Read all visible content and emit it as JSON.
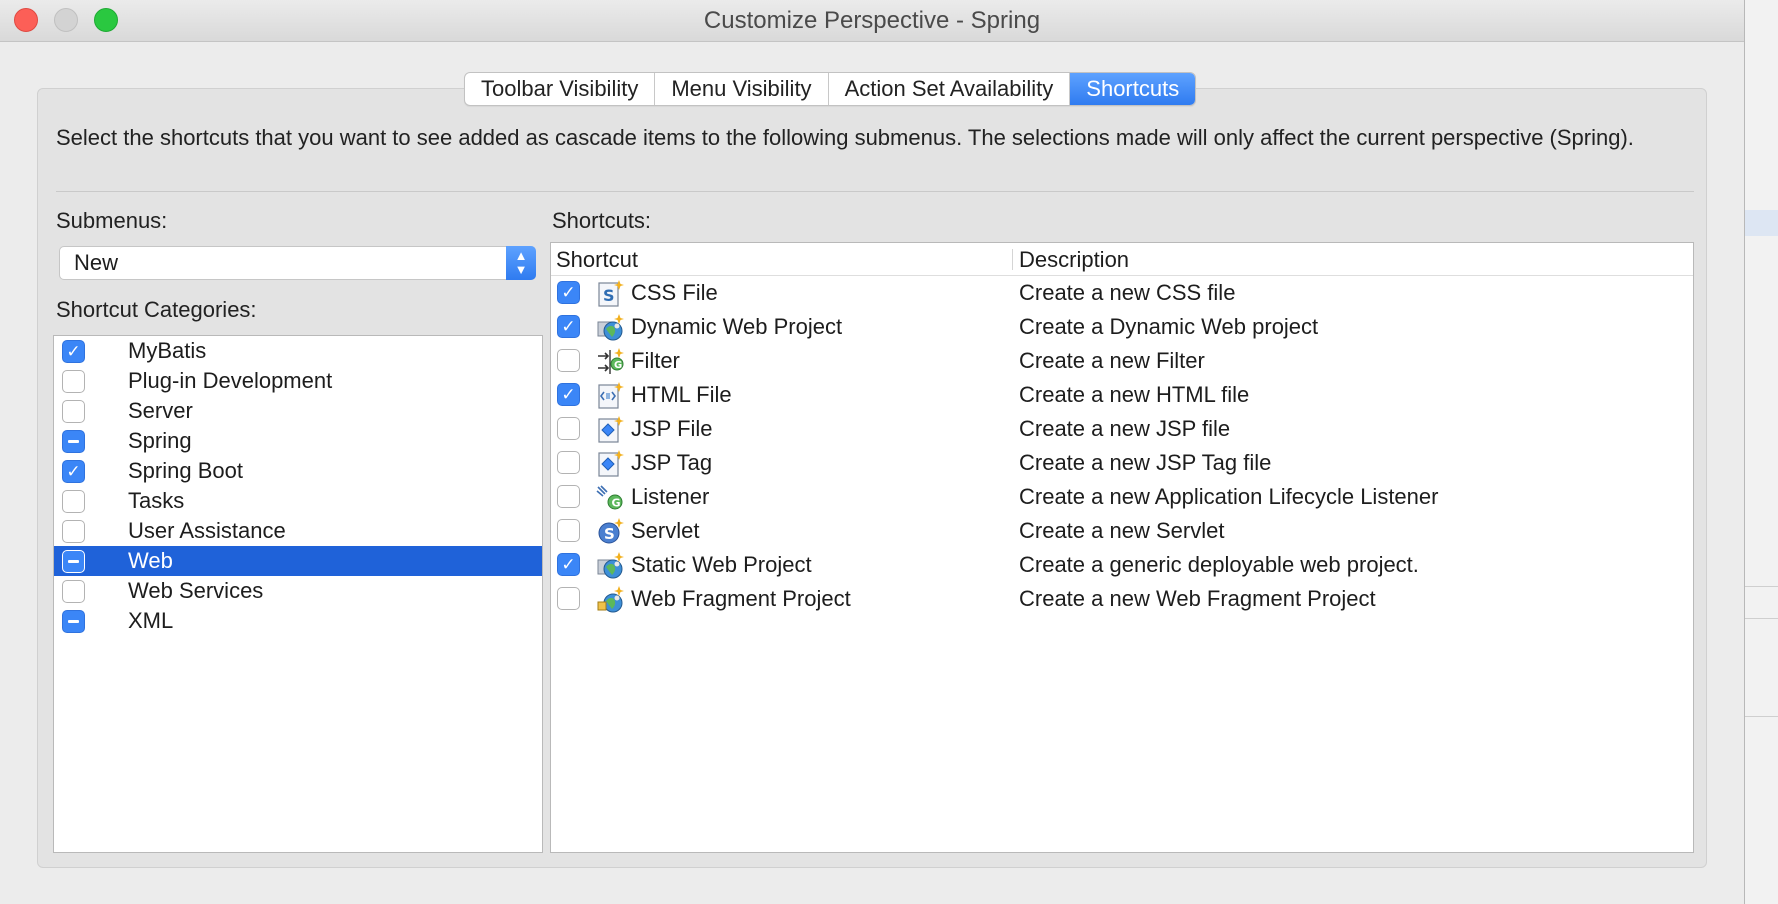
{
  "window": {
    "title": "Customize Perspective - Spring"
  },
  "tabs": [
    {
      "label": "Toolbar Visibility",
      "active": false
    },
    {
      "label": "Menu Visibility",
      "active": false
    },
    {
      "label": "Action Set Availability",
      "active": false
    },
    {
      "label": "Shortcuts",
      "active": true
    }
  ],
  "description": "Select the shortcuts that you want to see added as cascade items to the following submenus. The selections made will only affect the current perspective (Spring).",
  "submenus": {
    "label": "Submenus:",
    "selected": "New"
  },
  "categories": {
    "label": "Shortcut Categories:",
    "items": [
      {
        "label": "MyBatis",
        "state": "checked",
        "selected": false
      },
      {
        "label": "Plug-in Development",
        "state": "unchecked",
        "selected": false
      },
      {
        "label": "Server",
        "state": "unchecked",
        "selected": false
      },
      {
        "label": "Spring",
        "state": "mixed",
        "selected": false
      },
      {
        "label": "Spring Boot",
        "state": "checked",
        "selected": false
      },
      {
        "label": "Tasks",
        "state": "unchecked",
        "selected": false
      },
      {
        "label": "User Assistance",
        "state": "unchecked",
        "selected": false
      },
      {
        "label": "Web",
        "state": "mixed",
        "selected": true
      },
      {
        "label": "Web Services",
        "state": "unchecked",
        "selected": false
      },
      {
        "label": "XML",
        "state": "mixed",
        "selected": false
      }
    ]
  },
  "shortcuts": {
    "label": "Shortcuts:",
    "columns": [
      "Shortcut",
      "Description"
    ],
    "rows": [
      {
        "name": "CSS File",
        "description": "Create a new CSS file",
        "checked": true,
        "icon": "css-file-icon"
      },
      {
        "name": "Dynamic Web Project",
        "description": "Create a Dynamic Web project",
        "checked": true,
        "icon": "web-project-icon"
      },
      {
        "name": "Filter",
        "description": "Create a new Filter",
        "checked": false,
        "icon": "filter-icon"
      },
      {
        "name": "HTML File",
        "description": "Create a new HTML file",
        "checked": true,
        "icon": "html-file-icon"
      },
      {
        "name": "JSP File",
        "description": "Create a new JSP file",
        "checked": false,
        "icon": "jsp-file-icon"
      },
      {
        "name": "JSP Tag",
        "description": "Create a new JSP Tag file",
        "checked": false,
        "icon": "jsp-tag-icon"
      },
      {
        "name": "Listener",
        "description": "Create a new Application Lifecycle Listener",
        "checked": false,
        "icon": "listener-icon"
      },
      {
        "name": "Servlet",
        "description": "Create a new Servlet",
        "checked": false,
        "icon": "servlet-icon"
      },
      {
        "name": "Static Web Project",
        "description": "Create a generic deployable web project.",
        "checked": true,
        "icon": "static-web-project-icon"
      },
      {
        "name": "Web Fragment Project",
        "description": "Create a new Web Fragment Project",
        "checked": false,
        "icon": "web-fragment-project-icon"
      }
    ]
  },
  "colors": {
    "accent": "#3b86f7",
    "selection": "#1f62d9"
  }
}
